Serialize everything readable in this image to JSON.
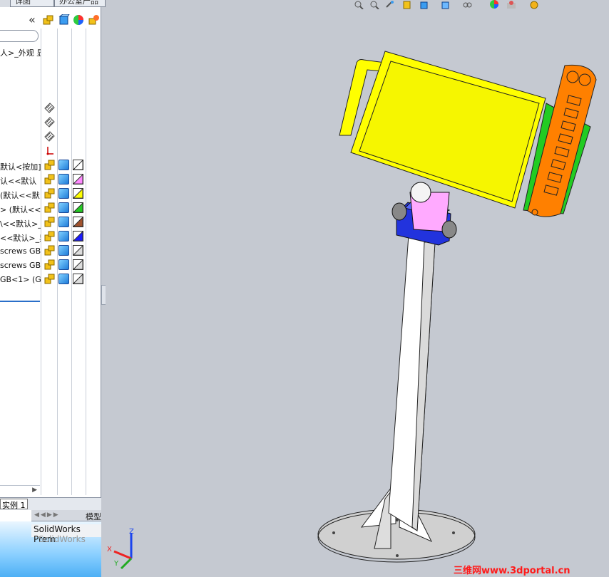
{
  "top_tabs": [
    "详图",
    "办公室产品"
  ],
  "panel": {
    "collapse_label": "«",
    "first_row": "人>_外观 显"
  },
  "tree_rows": [
    {
      "label": "默认<按加]",
      "color": "#ffffff"
    },
    {
      "label": "认<<默认",
      "color": "#ff88ff"
    },
    {
      "label": "(默认<<默",
      "color": "#ffff00"
    },
    {
      "label": "> (默认<<",
      "color": "#22cc22"
    },
    {
      "label": "\\<<默认>_",
      "color": "#a0522d"
    },
    {
      "label": "<<默认>_异",
      "color": "#1a1aff"
    },
    {
      "label": "screws GB",
      "color": "#dddddd"
    },
    {
      "label": "screws GB",
      "color": "#dddddd"
    },
    {
      "label": "GB<1> (G",
      "color": "#dddddd"
    }
  ],
  "bottom": {
    "tab_label": "实例 1",
    "model_tab": "模型",
    "solidworks_label": "SolidWorks Prem",
    "solidworks_label2": "SolidWorks Pre"
  },
  "viewport": {
    "triad_labels": {
      "x": "X",
      "y": "Y",
      "z": "Z"
    },
    "watermark": "三维网www.3dportal.cn"
  },
  "colors": {
    "viewport_bg": "#c5c9d1",
    "yellow_part": "#ffff00",
    "orange_part": "#ff8000",
    "blue_part": "#2233dd",
    "pink_part": "#ffaaff",
    "green_part": "#22cc22"
  }
}
